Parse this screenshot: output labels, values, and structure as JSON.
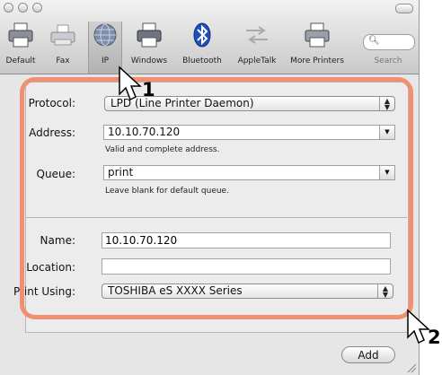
{
  "toolbar": {
    "items": [
      {
        "label": "Default",
        "icon": "default-printer-icon",
        "selected": false
      },
      {
        "label": "Fax",
        "icon": "fax-icon",
        "selected": false
      },
      {
        "label": "IP",
        "icon": "ip-globe-icon",
        "selected": true
      },
      {
        "label": "Windows",
        "icon": "windows-printer-icon",
        "selected": false
      },
      {
        "label": "Bluetooth",
        "icon": "bluetooth-icon",
        "selected": false
      },
      {
        "label": "AppleTalk",
        "icon": "appletalk-icon",
        "selected": false
      },
      {
        "label": "More Printers",
        "icon": "more-printers-icon",
        "selected": false
      }
    ],
    "search": {
      "label": "Search",
      "placeholder": ""
    }
  },
  "form": {
    "protocol": {
      "label": "Protocol:",
      "value": "LPD (Line Printer Daemon)"
    },
    "address": {
      "label": "Address:",
      "value": "10.10.70.120",
      "hint": "Valid and complete address."
    },
    "queue": {
      "label": "Queue:",
      "value": "print",
      "hint": "Leave blank for default queue."
    },
    "name": {
      "label": "Name:",
      "value": "10.10.70.120"
    },
    "location": {
      "label": "Location:",
      "value": ""
    },
    "print_using": {
      "label": "Print Using:",
      "value": "TOSHIBA eS XXXX Series"
    }
  },
  "buttons": {
    "add": "Add"
  },
  "callouts": {
    "step1": "1",
    "step2": "2"
  },
  "colors": {
    "highlight": "#f09070",
    "selected_tool": "#b8b8b8"
  }
}
